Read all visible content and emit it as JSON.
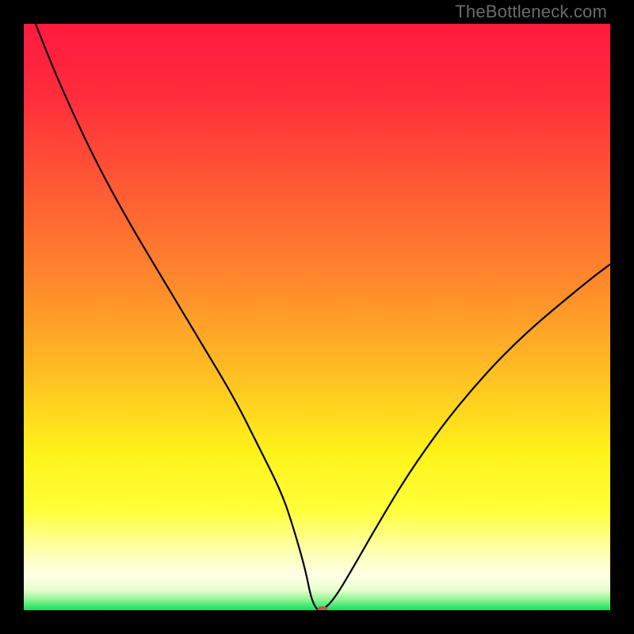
{
  "watermark": "TheBottleneck.com",
  "gradient": {
    "stops": [
      {
        "pct": 0,
        "color": "#ff1a3f"
      },
      {
        "pct": 12,
        "color": "#ff2c3c"
      },
      {
        "pct": 28,
        "color": "#ff5a34"
      },
      {
        "pct": 45,
        "color": "#ff8b2c"
      },
      {
        "pct": 60,
        "color": "#ffc022"
      },
      {
        "pct": 73,
        "color": "#fff21a"
      },
      {
        "pct": 83,
        "color": "#ffff3a"
      },
      {
        "pct": 90,
        "color": "#fdffb0"
      },
      {
        "pct": 94,
        "color": "#feffe6"
      },
      {
        "pct": 96.5,
        "color": "#e9ffd0"
      },
      {
        "pct": 98,
        "color": "#9df59a"
      },
      {
        "pct": 100,
        "color": "#11e05d"
      }
    ]
  },
  "chart_data": {
    "type": "line",
    "title": "",
    "xlabel": "",
    "ylabel": "",
    "xlim": [
      0,
      100
    ],
    "ylim": [
      0,
      100
    ],
    "series": [
      {
        "name": "bottleneck-curve",
        "x": [
          2,
          6,
          12,
          18,
          24,
          30,
          36,
          40,
          44,
          46,
          48,
          49,
          50,
          51,
          53,
          56,
          60,
          66,
          74,
          84,
          96,
          100
        ],
        "y": [
          100,
          90,
          77,
          66,
          56,
          46,
          36,
          28,
          20,
          14,
          7,
          2,
          0,
          0,
          2,
          7,
          14,
          24,
          35,
          46,
          56,
          59
        ]
      }
    ],
    "marker": {
      "x": 51,
      "y": 0,
      "color": "#bb5b53"
    },
    "legend": false,
    "grid": false
  }
}
